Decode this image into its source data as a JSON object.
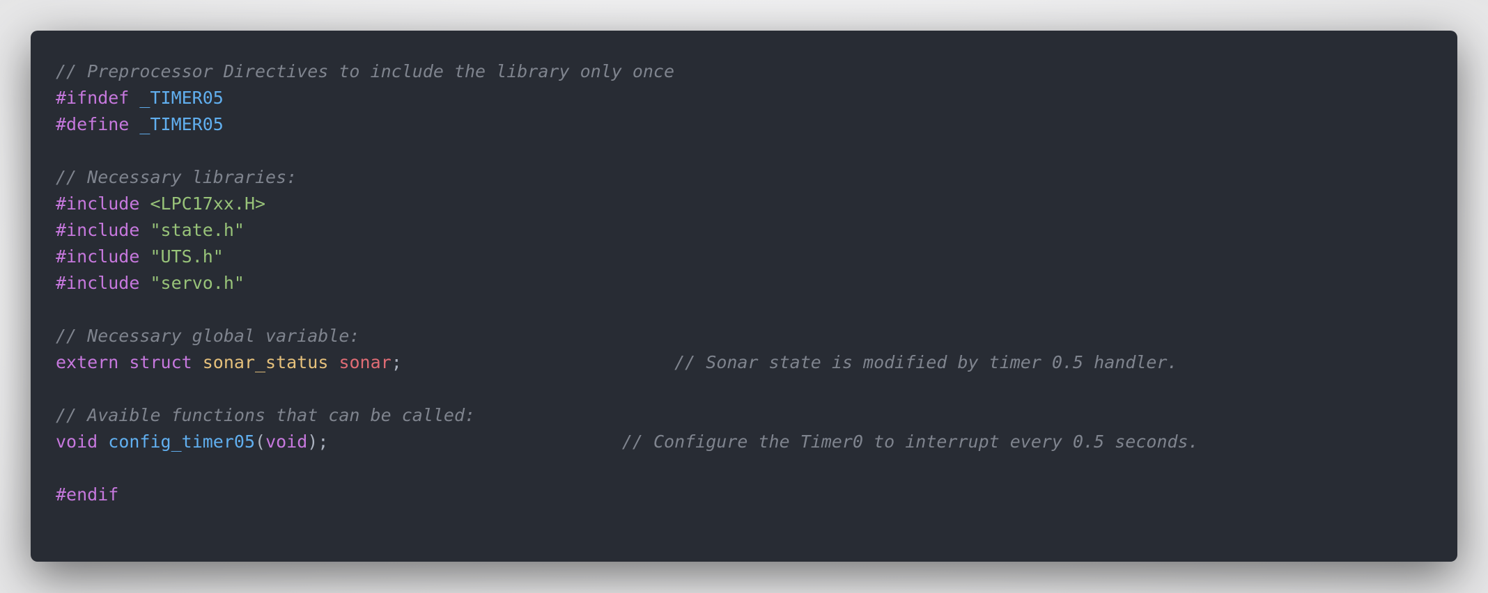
{
  "theme": {
    "background": "#282c34",
    "comment": "#7f848e",
    "keyword": "#c678dd",
    "macro": "#61afef",
    "string": "#98c379",
    "type": "#e5c07b",
    "variable": "#e06c75",
    "function": "#61afef",
    "punctuation": "#abb2bf"
  },
  "code": {
    "language": "c",
    "lines": [
      [
        {
          "t": "// Preprocessor Directives to include the library only once",
          "k": "comment"
        }
      ],
      [
        {
          "t": "#ifndef",
          "k": "keyword"
        },
        {
          "t": " ",
          "k": "plain"
        },
        {
          "t": "_TIMER05",
          "k": "macro"
        }
      ],
      [
        {
          "t": "#define",
          "k": "keyword"
        },
        {
          "t": " ",
          "k": "plain"
        },
        {
          "t": "_TIMER05",
          "k": "macro"
        }
      ],
      [],
      [
        {
          "t": "// Necessary libraries:",
          "k": "comment"
        }
      ],
      [
        {
          "t": "#include",
          "k": "keyword"
        },
        {
          "t": " ",
          "k": "plain"
        },
        {
          "t": "<LPC17xx.H>",
          "k": "string"
        }
      ],
      [
        {
          "t": "#include",
          "k": "keyword"
        },
        {
          "t": " ",
          "k": "plain"
        },
        {
          "t": "\"state.h\"",
          "k": "string"
        }
      ],
      [
        {
          "t": "#include",
          "k": "keyword"
        },
        {
          "t": " ",
          "k": "plain"
        },
        {
          "t": "\"UTS.h\"",
          "k": "string"
        }
      ],
      [
        {
          "t": "#include",
          "k": "keyword"
        },
        {
          "t": " ",
          "k": "plain"
        },
        {
          "t": "\"servo.h\"",
          "k": "string"
        }
      ],
      [],
      [
        {
          "t": "// Necessary global variable:",
          "k": "comment"
        }
      ],
      [
        {
          "t": "extern",
          "k": "keyword"
        },
        {
          "t": " ",
          "k": "plain"
        },
        {
          "t": "struct",
          "k": "keyword"
        },
        {
          "t": " ",
          "k": "plain"
        },
        {
          "t": "sonar_status",
          "k": "type"
        },
        {
          "t": " ",
          "k": "plain"
        },
        {
          "t": "sonar",
          "k": "var"
        },
        {
          "t": ";",
          "k": "punct"
        },
        {
          "t": "                          ",
          "k": "plain"
        },
        {
          "t": "// Sonar state is modified by timer 0.5 handler.",
          "k": "comment"
        }
      ],
      [],
      [
        {
          "t": "// Avaible functions that can be called:",
          "k": "comment"
        }
      ],
      [
        {
          "t": "void",
          "k": "keyword"
        },
        {
          "t": " ",
          "k": "plain"
        },
        {
          "t": "config_timer05",
          "k": "func"
        },
        {
          "t": "(",
          "k": "punct"
        },
        {
          "t": "void",
          "k": "keyword"
        },
        {
          "t": ");",
          "k": "punct"
        },
        {
          "t": "                            ",
          "k": "plain"
        },
        {
          "t": "// Configure the Timer0 to interrupt every 0.5 seconds.",
          "k": "comment"
        }
      ],
      [],
      [
        {
          "t": "#endif",
          "k": "keyword"
        }
      ]
    ]
  }
}
